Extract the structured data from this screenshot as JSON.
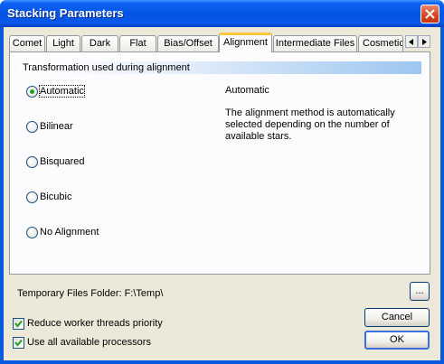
{
  "window": {
    "title": "Stacking Parameters"
  },
  "tabs": [
    {
      "label": "Comet",
      "active": false
    },
    {
      "label": "Light",
      "active": false
    },
    {
      "label": "Dark",
      "active": false
    },
    {
      "label": "Flat",
      "active": false
    },
    {
      "label": "Bias/Offset",
      "active": false
    },
    {
      "label": "Alignment",
      "active": true
    },
    {
      "label": "Intermediate Files",
      "active": false
    },
    {
      "label": "Cosmetic",
      "active": false
    }
  ],
  "tab_scroll": {
    "left_icon": "arrow-left-icon",
    "right_icon": "arrow-right-icon"
  },
  "alignment": {
    "group_title": "Transformation used during alignment",
    "options": [
      {
        "label": "Automatic",
        "selected": true
      },
      {
        "label": "Bilinear",
        "selected": false
      },
      {
        "label": "Bisquared",
        "selected": false
      },
      {
        "label": "Bicubic",
        "selected": false
      },
      {
        "label": "No Alignment",
        "selected": false
      }
    ],
    "description_title": "Automatic",
    "description_text": "The alignment method is automatically selected depending on the number of available stars."
  },
  "temp_folder": {
    "label": "Temporary Files Folder:  F:\\Temp\\",
    "browse_label": "..."
  },
  "checkboxes": [
    {
      "label": "Reduce worker threads priority",
      "checked": true
    },
    {
      "label": "Use all available processors",
      "checked": true
    }
  ],
  "buttons": {
    "cancel": "Cancel",
    "ok": "OK"
  },
  "colors": {
    "title_bar": "#0554e4",
    "close_button": "#d6441e",
    "dialog_bg": "#ece9d8",
    "active_tab_accent": "#ffc83c",
    "radio_dot": "#21a121",
    "check_mark": "#21a121"
  }
}
